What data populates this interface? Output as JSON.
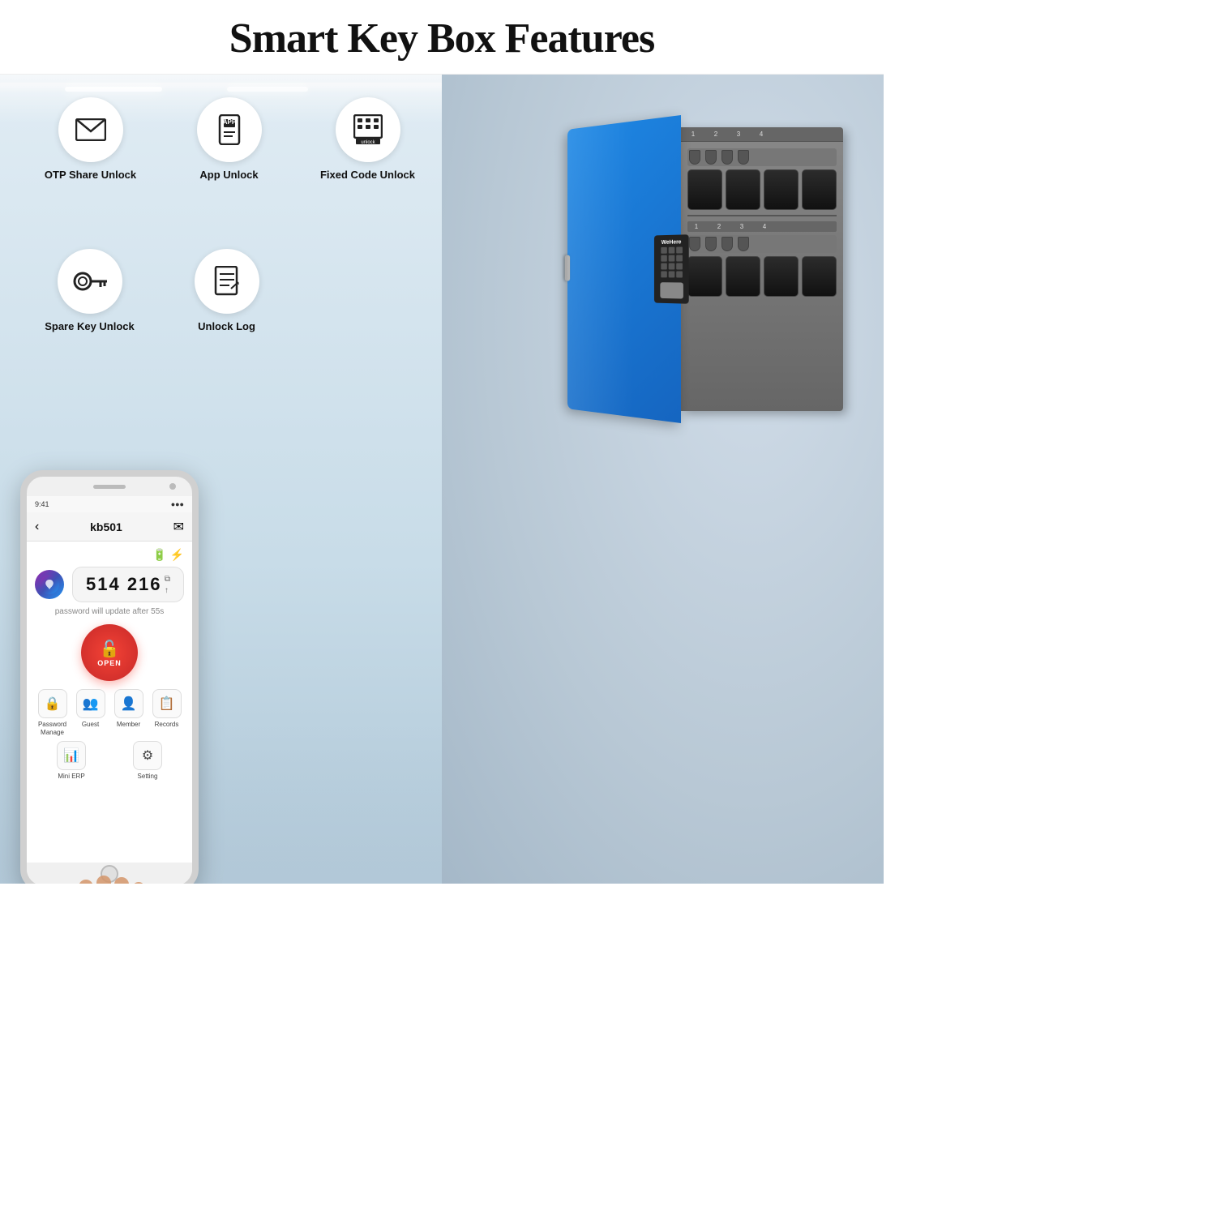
{
  "header": {
    "title": "Smart Key Box Features"
  },
  "features": {
    "top_row": [
      {
        "id": "otp-share-unlock",
        "icon": "✉",
        "label": "OTP Share Unlock"
      },
      {
        "id": "app-unlock",
        "icon": "📱",
        "label": "App Unlock"
      },
      {
        "id": "fixed-code-unlock",
        "icon": "⌨",
        "label": "Fixed Code Unlock"
      }
    ],
    "bottom_row": [
      {
        "id": "spare-key-unlock",
        "icon": "🔑",
        "label": "Spare Key Unlock"
      },
      {
        "id": "unlock-log",
        "icon": "📋",
        "label": "Unlock Log"
      }
    ]
  },
  "phone": {
    "app_name": "kb501",
    "otp_code": "514 216",
    "update_text": "password will update after 55s",
    "open_button_label": "OPEN",
    "battery_status": "🔋",
    "bt_status": "⚡",
    "menu_items": [
      {
        "icon": "🔒",
        "label": "Password\nManage"
      },
      {
        "icon": "👥",
        "label": "Guest"
      },
      {
        "icon": "👤",
        "label": "Member"
      },
      {
        "icon": "📋",
        "label": "Records"
      },
      {
        "icon": "📊",
        "label": "Mini ERP"
      },
      {
        "icon": "⚙",
        "label": "Setting"
      }
    ]
  },
  "key_box": {
    "brand": "WeHere",
    "color": "#1e88e5"
  },
  "colors": {
    "accent_blue": "#1e88e5",
    "open_red": "#f44336",
    "bg_left": "#c8d8e4",
    "bg_right": "#b8c8d5"
  }
}
